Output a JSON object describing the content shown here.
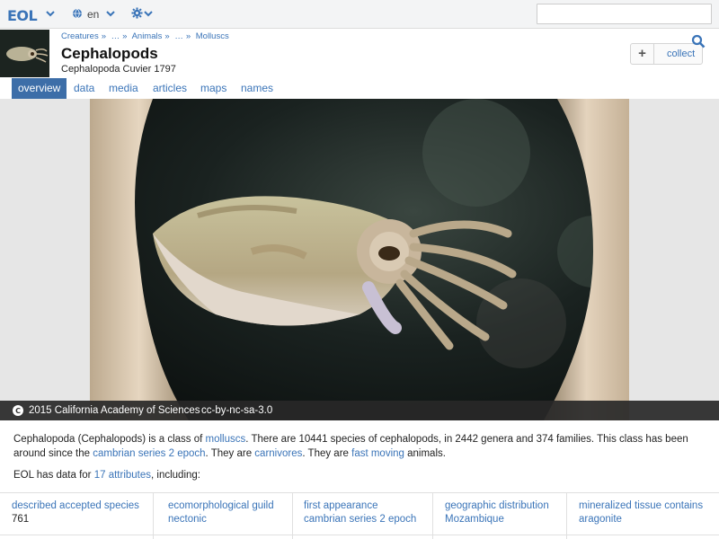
{
  "topbar": {
    "logo": "EOL",
    "language": "en",
    "search_placeholder": ""
  },
  "header": {
    "breadcrumb": [
      "Creatures",
      "…",
      "Animals",
      "…",
      "Molluscs"
    ],
    "breadcrumb_sep": "»",
    "title": "Cephalopods",
    "subtitle": "Cephalopoda Cuvier 1797",
    "collect_icon": "+",
    "collect_label": "collect"
  },
  "tabs": [
    "overview",
    "data",
    "media",
    "articles",
    "maps",
    "names"
  ],
  "active_tab": "overview",
  "image": {
    "credit": "2015 California Academy of Sciences",
    "license": "cc-by-nc-sa-3.0"
  },
  "summary": {
    "p1": "Cephalopoda (Cephalopods) is a class of ",
    "link1": "molluscs",
    "p2": ". There are 10441 species of cephalopods, in 2442 genera and 374 families. This class has been around since the ",
    "link2": "cambrian series 2 epoch",
    "p3": ". They are ",
    "link3": "carnivores",
    "p4": ". They are ",
    "link4": "fast moving",
    "p5": " animals."
  },
  "data_heading": {
    "prefix": "EOL has data for ",
    "link": "17 attributes",
    "suffix": ", including:"
  },
  "attributes": [
    {
      "label": "described accepted species",
      "value": "761"
    },
    {
      "label": "ecomorphological guild",
      "value": "nectonic"
    },
    {
      "label": "first appearance",
      "value": "cambrian series 2 epoch"
    },
    {
      "label": "geographic distribution",
      "value": "Mozambique"
    },
    {
      "label": "mineralized tissue contains",
      "value": "aragonite"
    }
  ],
  "colors": {
    "link": "#3a74b8",
    "active_tab": "#3d6ea8",
    "topbar": "#f3f4f5"
  },
  "icons": [
    "chevron-down-icon",
    "globe-icon",
    "gear-icon",
    "search-icon",
    "creative-commons-icon"
  ]
}
